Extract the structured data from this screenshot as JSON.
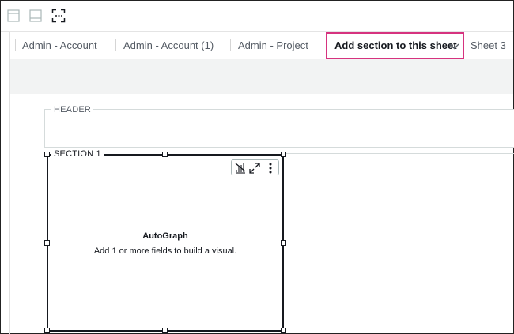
{
  "toolbar": {
    "icons": [
      "layout-header-icon",
      "layout-footer-icon",
      "fit-to-screen-icon"
    ]
  },
  "sheets": {
    "tabs": [
      {
        "label": "Admin - Account"
      },
      {
        "label": "Admin - Account (1)"
      },
      {
        "label": "Admin - Project"
      },
      {
        "label": "Add section to this sheet",
        "active": true
      },
      {
        "label": "Sheet 3"
      }
    ],
    "active_dropdown_icon": "chevron-down-icon"
  },
  "layout": {
    "header_label": "HEADER",
    "section_label": "SECTION 1"
  },
  "visual": {
    "toolbar_icons": [
      "autograph-icon",
      "expand-icon",
      "more-options-icon"
    ],
    "title": "AutoGraph",
    "message": "Add 1 or more fields to build a visual."
  },
  "colors": {
    "active_tab_border": "#d6337f",
    "text": "#16191f",
    "muted_text": "#545b64",
    "canvas_band": "#f2f3f3"
  }
}
